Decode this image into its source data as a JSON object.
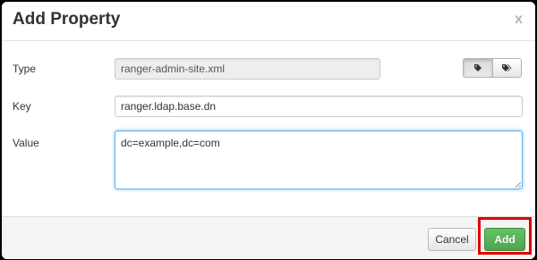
{
  "dialog": {
    "title": "Add Property",
    "close_glyph": "x"
  },
  "form": {
    "type_label": "Type",
    "type_value": "ranger-admin-site.xml",
    "key_label": "Key",
    "key_value": "ranger.ldap.base.dn",
    "value_label": "Value",
    "value_value": "dc=example,dc=com"
  },
  "tag_buttons": [
    {
      "icon": "tag-icon",
      "active": true
    },
    {
      "icon": "tags-icon",
      "active": false
    }
  ],
  "footer": {
    "cancel_label": "Cancel",
    "add_label": "Add"
  },
  "colors": {
    "add_button": "#5bb75b",
    "highlight": "#e00000",
    "focus_border": "#66afe9"
  }
}
